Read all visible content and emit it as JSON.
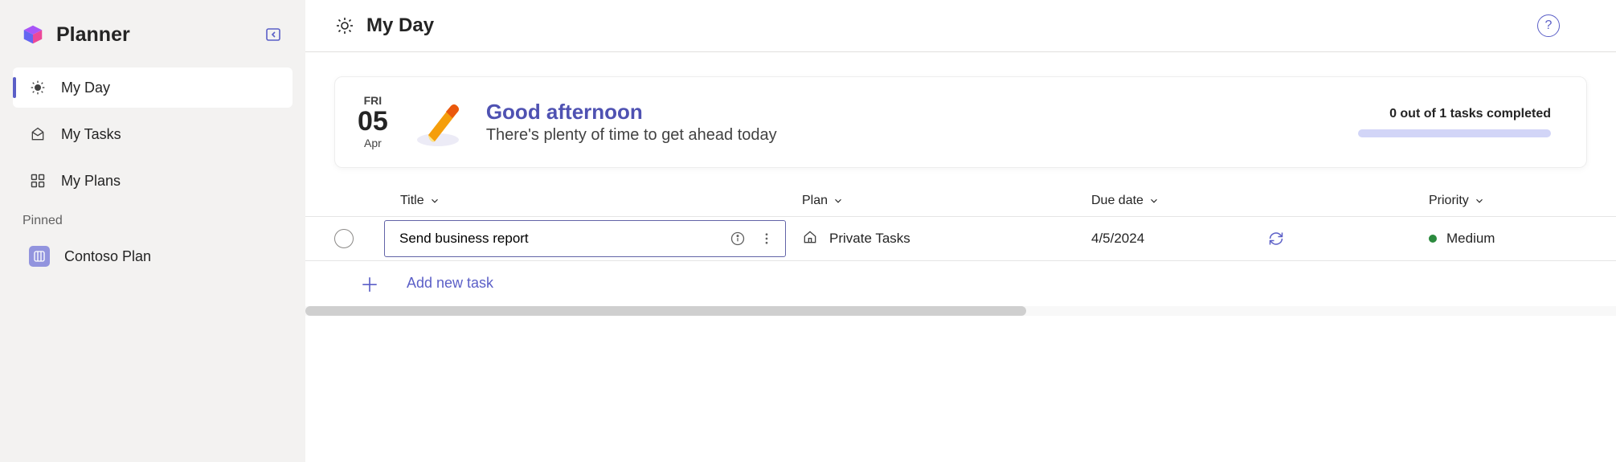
{
  "app": {
    "title": "Planner"
  },
  "sidebar": {
    "items": [
      {
        "label": "My Day",
        "icon": "sun-icon",
        "active": true
      },
      {
        "label": "My Tasks",
        "icon": "inbox-icon",
        "active": false
      },
      {
        "label": "My Plans",
        "icon": "grid-icon",
        "active": false
      }
    ],
    "pinned_label": "Pinned",
    "pinned": [
      {
        "label": "Contoso Plan",
        "icon": "board-icon"
      }
    ]
  },
  "header": {
    "title": "My Day"
  },
  "card": {
    "date": {
      "dow": "FRI",
      "day": "05",
      "month": "Apr"
    },
    "greeting": "Good afternoon",
    "subtitle": "There's plenty of time to get ahead today",
    "progress_text": "0 out of 1 tasks completed",
    "progress_value": 0,
    "progress_max": 1
  },
  "columns": {
    "title": "Title",
    "plan": "Plan",
    "due": "Due date",
    "priority": "Priority"
  },
  "tasks": [
    {
      "title": "Send business report",
      "plan": "Private Tasks",
      "due": "4/5/2024",
      "recurring": true,
      "priority": "Medium",
      "priority_color": "#2b8a3e",
      "completed": false
    }
  ],
  "add_task_label": "Add new task",
  "colors": {
    "accent": "#5b5fc7"
  }
}
